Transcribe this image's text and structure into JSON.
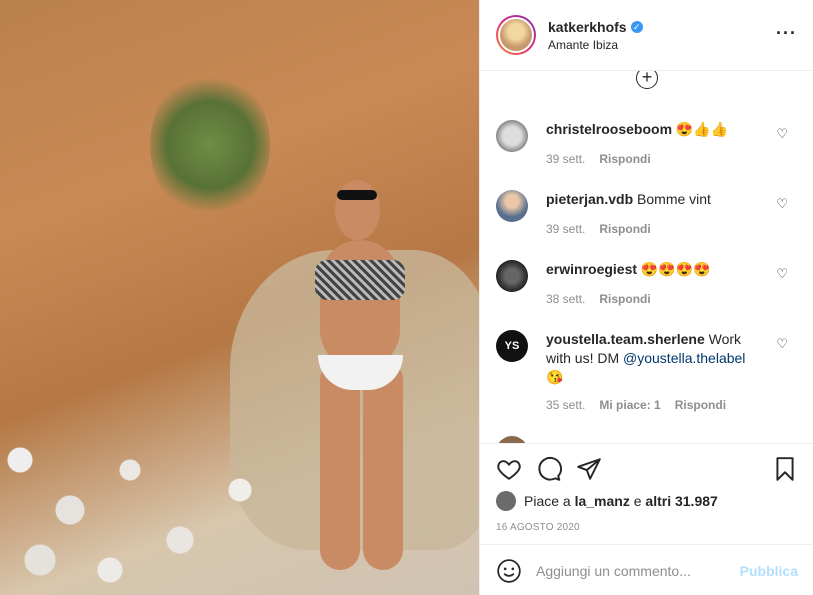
{
  "post": {
    "username": "katkerkhofs",
    "location": "Amante Ibiza",
    "verified": true
  },
  "comments": [
    {
      "user": "christelrooseboom",
      "text": "😍👍👍",
      "age": "39 sett.",
      "reply": "Rispondi",
      "likes": ""
    },
    {
      "user": "pieterjan.vdb",
      "text": "Bomme vint",
      "age": "39 sett.",
      "reply": "Rispondi",
      "likes": ""
    },
    {
      "user": "erwinroegiest",
      "text": "😍😍😍😍",
      "age": "38 sett.",
      "reply": "Rispondi",
      "likes": ""
    },
    {
      "user": "youstella.team.sherlene",
      "text": "Work with us! DM",
      "mention": "@youstella.thelabel",
      "emoji": "😘",
      "age": "35 sett.",
      "likes": "Mi piace: 1",
      "reply": "Rispondi"
    }
  ],
  "likes": {
    "prefix": "Piace a",
    "user": "la_manz",
    "middle": "e",
    "count": "altri 31.987"
  },
  "date": "16 AGOSTO 2020",
  "add_comment": {
    "placeholder": "Aggiungi un commento...",
    "publish_label": "Pubblica"
  },
  "icons": {
    "like": "heart-icon",
    "comment": "comment-icon",
    "share": "share-icon",
    "save": "bookmark-icon",
    "more": "more-icon",
    "emoji": "smiley-icon",
    "load_more": "plus-circle-icon"
  },
  "colors": {
    "verified": "#3897f0",
    "publish": "#b2dffc",
    "meta": "#8e8e8e",
    "mention": "#00376b"
  }
}
